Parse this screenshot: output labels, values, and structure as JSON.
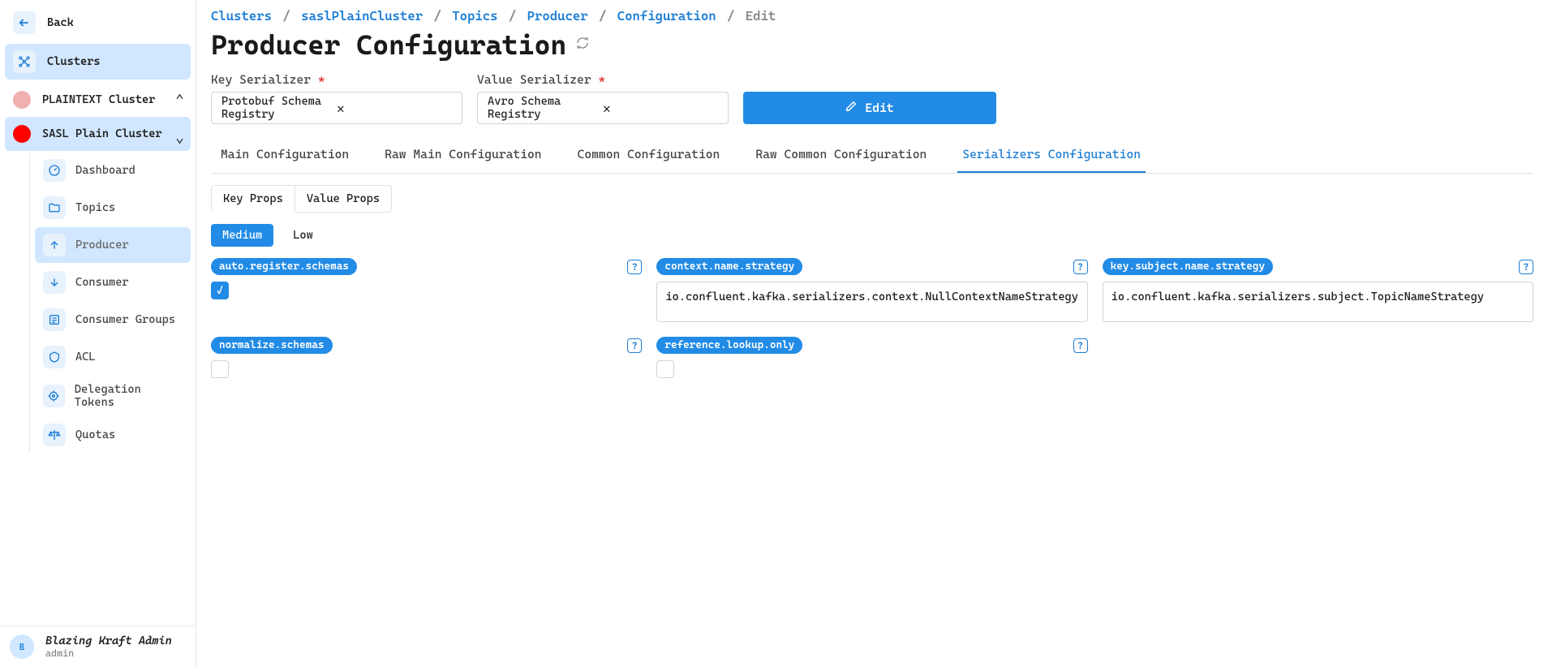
{
  "sidebar": {
    "back_label": "Back",
    "clusters_label": "Clusters",
    "cluster1": "PLAINTEXT Cluster",
    "cluster2": "SASL Plain Cluster",
    "items": {
      "dashboard": "Dashboard",
      "topics": "Topics",
      "producer": "Producer",
      "consumer": "Consumer",
      "consumer_groups": "Consumer Groups",
      "acl": "ACL",
      "delegation_tokens": "Delegation Tokens",
      "quotas": "Quotas"
    },
    "user": {
      "name": "Blazing Kraft Admin",
      "sub": "admin",
      "initial": "B"
    }
  },
  "breadcrumb": {
    "p0": "Clusters",
    "p1": "saslPlainCluster",
    "p2": "Topics",
    "p3": "Producer",
    "p4": "Configuration",
    "p5": "Edit"
  },
  "page_title": "Producer Configuration",
  "form": {
    "key_label": "Key Serializer",
    "key_value": "Protobuf Schema Registry",
    "val_label": "Value Serializer",
    "val_value": "Avro Schema Registry",
    "edit_label": "Edit"
  },
  "tabs": {
    "t0": "Main Configuration",
    "t1": "Raw Main Configuration",
    "t2": "Common Configuration",
    "t3": "Raw Common Configuration",
    "t4": "Serializers Configuration"
  },
  "subtabs": {
    "s0": "Key Props",
    "s1": "Value Props"
  },
  "chips": {
    "c0": "Medium",
    "c1": "Low"
  },
  "props": {
    "auto_register": {
      "name": "auto.register.schemas",
      "checked": true
    },
    "context_strategy": {
      "name": "context.name.strategy",
      "value": "io.confluent.kafka.serializers.context.NullContextNameStrategy"
    },
    "key_subject": {
      "name": "key.subject.name.strategy",
      "value": "io.confluent.kafka.serializers.subject.TopicNameStrategy"
    },
    "normalize": {
      "name": "normalize.schemas",
      "checked": false
    },
    "ref_lookup": {
      "name": "reference.lookup.only",
      "checked": false
    }
  }
}
